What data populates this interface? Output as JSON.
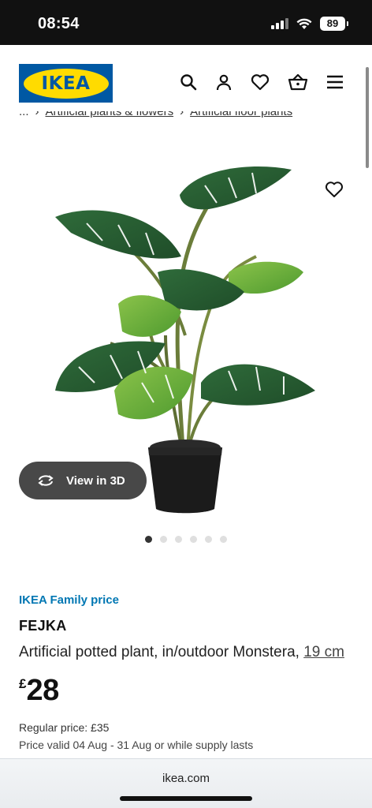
{
  "status_bar": {
    "time": "08:54",
    "battery": "89"
  },
  "header": {
    "logo_text": "IKEA"
  },
  "breadcrumb": [
    "...",
    "Artificial plants & flowers",
    "Artificial floor plants"
  ],
  "gallery": {
    "view_3d_label": "View in 3D",
    "image_count": 6,
    "active_image": 1
  },
  "product": {
    "family_price_label": "IKEA Family price",
    "name": "FEJKA",
    "description": "Artificial potted plant, in/outdoor Monstera,",
    "size": "19 cm",
    "currency": "£",
    "price": "28",
    "regular_price": "Regular price: £35",
    "validity": "Price valid 04 Aug - 31 Aug or while supply lasts"
  },
  "browser": {
    "url": "ikea.com"
  },
  "colors": {
    "brand_blue": "#0058a3",
    "brand_yellow": "#ffdb00",
    "family_blue": "#0077b3"
  }
}
